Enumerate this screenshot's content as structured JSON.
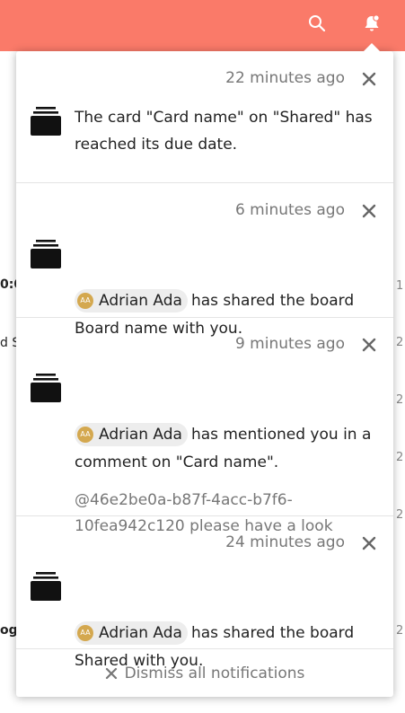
{
  "background": {
    "left_fragments": [
      "0:0",
      "d S",
      "og"
    ],
    "right_fragments": [
      "1",
      "2",
      "2",
      "2",
      "2",
      "2"
    ]
  },
  "notifications": [
    {
      "time": "22 minutes ago",
      "text": "The card \"Card name\" on \"Shared\" has reached its due date."
    },
    {
      "time": "6 minutes ago",
      "user": {
        "initials": "AA",
        "name": "Adrian Ada"
      },
      "text": "has shared the board Board name with you."
    },
    {
      "time": "9 minutes ago",
      "user": {
        "initials": "AA",
        "name": "Adrian Ada"
      },
      "text": "has mentioned you in a comment on \"Card name\".",
      "message": "@46e2be0a-b87f-4acc-b7f6-10fea942c120 please have a look"
    },
    {
      "time": "24 minutes ago",
      "user": {
        "initials": "AA",
        "name": "Adrian Ada"
      },
      "text": "has shared the board Shared with you."
    }
  ],
  "dismiss_all_label": "Dismiss all notifications"
}
